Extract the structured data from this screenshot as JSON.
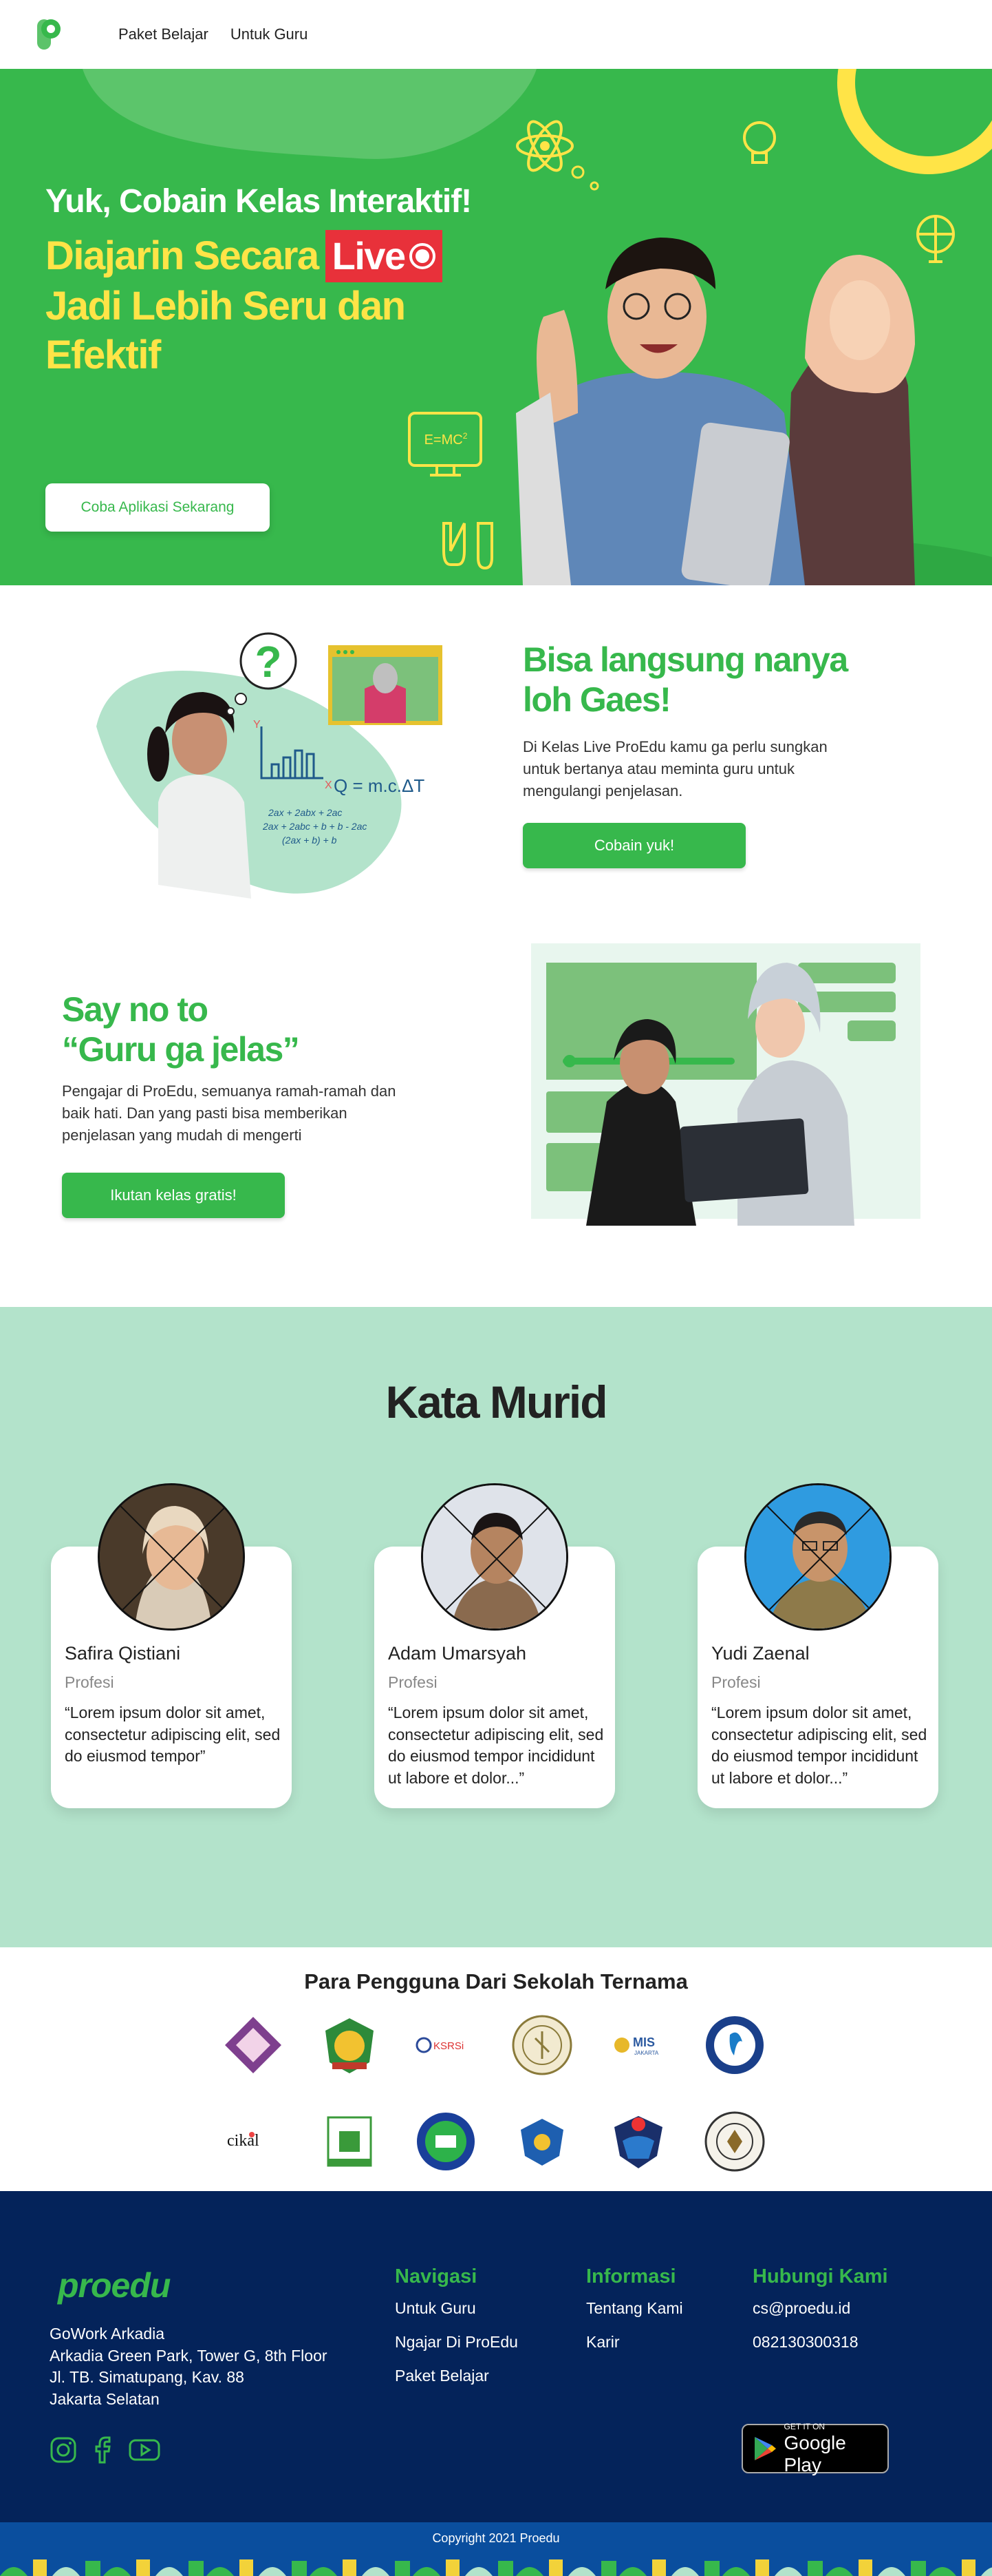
{
  "nav": {
    "links": [
      "Paket Belajar",
      "Untuk Guru"
    ]
  },
  "hero": {
    "line1": "Yuk, Cobain Kelas Interaktif!",
    "line2": "Diajarin Secara",
    "live": "Live",
    "line3": "Jadi Lebih Seru dan",
    "line4": "Efektif",
    "formula": "E=MC",
    "formula_sup": "2",
    "cta": "Coba Aplikasi Sekarang"
  },
  "feature1": {
    "title_line1": "Bisa langsung nanya",
    "title_line2": "loh Gaes!",
    "desc_line1": "Di Kelas Live ProEdu kamu ga perlu sungkan",
    "desc_line2": "untuk bertanya atau meminta guru untuk",
    "desc_line3": "mengulangi penjelasan.",
    "button": "Cobain yuk!",
    "art": {
      "question": "?",
      "axis_y": "Y",
      "axis_x": "X",
      "formula": "Q = m.c.ΔT",
      "eq1": "2ax + 2abx + 2ac",
      "eq2": "2ax + 2abc + b + b - 2ac",
      "eq3": "(2ax + b) + b"
    }
  },
  "feature2": {
    "title_line1": "Say no to",
    "title_line2": "“Guru ga jelas”",
    "desc_line1": "Pengajar di ProEdu, semuanya ramah-ramah dan",
    "desc_line2": "baik hati. Dan yang pasti bisa memberikan",
    "desc_line3": "penjelasan yang mudah di mengerti",
    "button": "Ikutan kelas gratis!"
  },
  "testimonials": {
    "title": "Kata Murid",
    "items": [
      {
        "name": "Safira Qistiani",
        "role": "Profesi",
        "quote": "“Lorem ipsum dolor sit amet, consectetur adipiscing elit, sed do eiusmod tempor”"
      },
      {
        "name": "Adam Umarsyah",
        "role": "Profesi",
        "quote": "“Lorem ipsum dolor sit amet, consectetur adipiscing elit, sed do eiusmod tempor incididunt ut labore et dolor...”"
      },
      {
        "name": "Yudi Zaenal",
        "role": "Profesi",
        "quote": "“Lorem ipsum dolor sit amet, consectetur adipiscing elit, sed do eiusmod tempor incididunt ut labore et dolor...”"
      }
    ]
  },
  "schools": {
    "title": "Para Pengguna Dari Sekolah Ternama",
    "logo_texts": {
      "mis": "MIS",
      "mis_sub": "JAKARTA",
      "ksrisi": "KSRSi",
      "cikal": "cikal"
    }
  },
  "footer": {
    "brand": "proedu",
    "address": [
      "GoWork Arkadia",
      "Arkadia Green Park, Tower G, 8th Floor",
      "Jl. TB. Simatupang, Kav. 88",
      "Jakarta Selatan"
    ],
    "nav_title": "Navigasi",
    "nav_items": [
      "Untuk Guru",
      "Ngajar Di ProEdu",
      "Paket Belajar"
    ],
    "info_title": "Informasi",
    "info_items": [
      "Tentang Kami",
      "Karir"
    ],
    "contact_title": "Hubungi Kami",
    "contact_items": [
      "cs@proedu.id",
      "082130300318"
    ],
    "gplay_small": "GET IT ON",
    "gplay_big": "Google Play",
    "copyright": "Copyright 2021 Proedu"
  },
  "colors": {
    "brand_green": "#37b84c",
    "accent_yellow": "#ffe447",
    "footer_navy": "#04235a",
    "testimonial_bg": "#b3e3cb"
  }
}
